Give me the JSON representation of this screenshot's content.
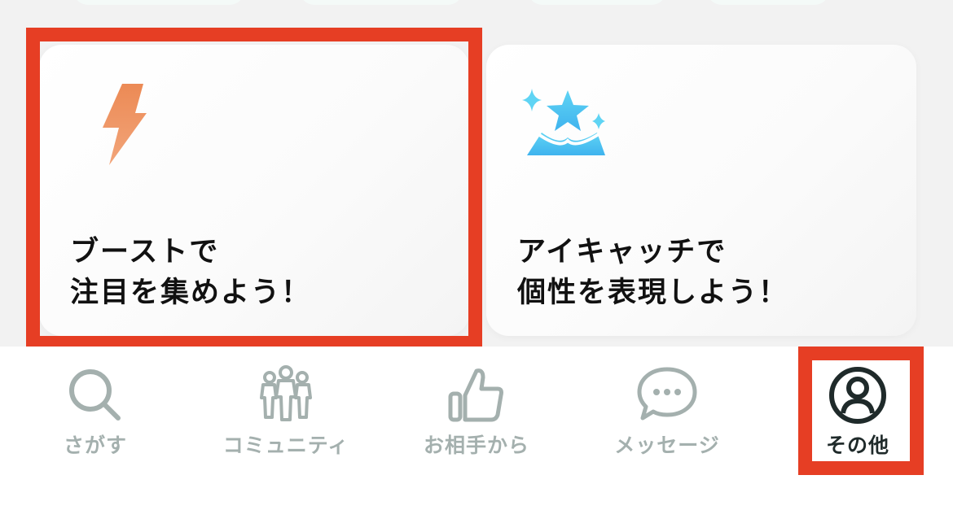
{
  "cards": [
    {
      "id": "boost",
      "title_line1": "ブーストで",
      "title_line2": "注目を集めよう！",
      "icon": "lightning-icon",
      "icon_color": "#f0845a"
    },
    {
      "id": "eyecatch",
      "title_line1": "アイキャッチで",
      "title_line2": "個性を表現しよう！",
      "icon": "sparkle-star-icon",
      "icon_color": "#4ec3f2"
    }
  ],
  "tabbar": {
    "items": [
      {
        "label": "さがす",
        "icon": "search-icon",
        "active": false
      },
      {
        "label": "コミュニティ",
        "icon": "community-people-icon",
        "active": false
      },
      {
        "label": "お相手から",
        "icon": "thumbs-up-icon",
        "active": false
      },
      {
        "label": "メッセージ",
        "icon": "chat-bubble-icon",
        "active": false
      },
      {
        "label": "その他",
        "icon": "user-profile-icon",
        "active": true
      }
    ]
  },
  "colors": {
    "highlight": "#e63e24",
    "inactive_tab": "#a4b0ae",
    "active_tab": "#1f2a2a"
  }
}
